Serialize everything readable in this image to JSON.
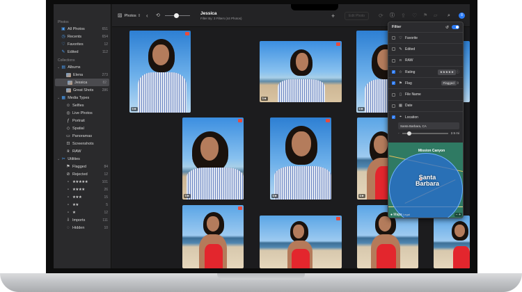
{
  "sidebar": {
    "photos_header": "Photos",
    "photos_items": [
      {
        "label": "All Photos",
        "count": "651",
        "icon": "photo-stack-icon"
      },
      {
        "label": "Recents",
        "count": "654",
        "icon": "clock-icon"
      },
      {
        "label": "Favorites",
        "count": "12",
        "icon": "heart-icon"
      },
      {
        "label": "Edited",
        "count": "112",
        "icon": "edit-icon"
      }
    ],
    "collections_header": "Collections",
    "albums_label": "Albums",
    "albums_items": [
      {
        "label": "Elena",
        "count": "273"
      },
      {
        "label": "Jessica",
        "count": "82"
      },
      {
        "label": "Great Shots",
        "count": "286"
      }
    ],
    "media_types_label": "Media Types",
    "media_types_items": [
      "Selfies",
      "Live Photos",
      "Portrait",
      "Spatial",
      "Panoramas",
      "Screenshots",
      "RAW"
    ],
    "utilities_label": "Utilities",
    "utilities_items": [
      {
        "label": "Flagged",
        "count": "84"
      },
      {
        "label": "Rejected",
        "count": "12"
      },
      {
        "label": "★★★★★",
        "count": "101"
      },
      {
        "label": "★★★★",
        "count": "26"
      },
      {
        "label": "★★★",
        "count": "15"
      },
      {
        "label": "★★",
        "count": "5"
      },
      {
        "label": "★",
        "count": "12"
      },
      {
        "label": "Imports",
        "count": "111"
      },
      {
        "label": "Hidden",
        "count": "10"
      }
    ]
  },
  "toolbar": {
    "library_label": "Photos",
    "title": "Jessica",
    "subtitle": "Filter By: 3 Filters (44 Photos)",
    "edit_label": "Edit Photo",
    "zoom_level": 0.45
  },
  "grid": {
    "badge": "5★"
  },
  "filter_panel": {
    "title": "Filter",
    "enabled": true,
    "rows": [
      {
        "label": "Favorite",
        "checked": false,
        "icon": "heart-icon"
      },
      {
        "label": "Edited",
        "checked": false,
        "icon": "edit-icon"
      },
      {
        "label": "RAW",
        "checked": false,
        "icon": "raw-icon"
      },
      {
        "label": "Rating",
        "checked": true,
        "icon": "star-icon",
        "value": "★★★★★"
      },
      {
        "label": "Flag",
        "checked": true,
        "icon": "flag-icon",
        "value": "Flagged"
      },
      {
        "label": "File Name",
        "checked": false,
        "icon": "document-icon"
      },
      {
        "label": "Date",
        "checked": false,
        "icon": "calendar-icon"
      },
      {
        "label": "Location",
        "checked": true,
        "icon": "location-icon"
      }
    ],
    "location_value": "Santa Barbara, CA",
    "radius_value": "2.5 mi",
    "map": {
      "area_label": "Mission Canyon",
      "city_label": "Santa Barbara",
      "attribution": "Maps",
      "legal": "Legal",
      "zoom_controls": "−  +"
    }
  },
  "colors": {
    "accent": "#2d7cf6",
    "flag": "#e94b3c"
  }
}
